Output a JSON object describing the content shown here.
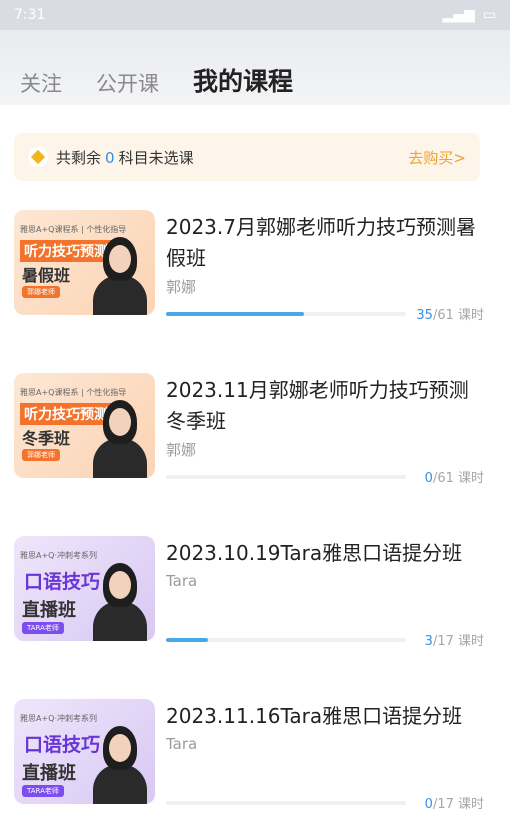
{
  "status_bar": {
    "time": "7:31"
  },
  "tabs": [
    {
      "label": "关注",
      "active": false
    },
    {
      "label": "公开课",
      "active": false
    },
    {
      "label": "我的课程",
      "active": true
    }
  ],
  "banner": {
    "prefix": "共剩余",
    "count": "0",
    "suffix": "科目未选课",
    "buy_label": "去购买>"
  },
  "courses": [
    {
      "title": "2023.7月郭娜老师听力技巧预测暑假班",
      "teacher": "郭娜",
      "done": "35",
      "total": "/61 课时",
      "progress": 0.574,
      "thumb": {
        "theme": "orange",
        "top": "雅思A+Q课程系 | 个性化指导",
        "line1": "听力技巧预测",
        "line2": "暑假班",
        "tag": "郭娜老师"
      }
    },
    {
      "title": "2023.11月郭娜老师听力技巧预测冬季班",
      "teacher": "郭娜",
      "done": "0",
      "total": "/61 课时",
      "progress": 0.0,
      "thumb": {
        "theme": "orange",
        "top": "雅思A+Q课程系 | 个性化指导",
        "line1": "听力技巧预测",
        "line2": "冬季班",
        "tag": "郭娜老师"
      }
    },
    {
      "title": "2023.10.19Tara雅思口语提分班",
      "teacher": "Tara",
      "done": "3",
      "total": "/17 课时",
      "progress": 0.176,
      "thumb": {
        "theme": "purple",
        "top": "雅思A+Q·冲刺考系列",
        "line1": "口语技巧",
        "line2": "直播班",
        "tag": "TARA老师"
      }
    },
    {
      "title": "2023.11.16Tara雅思口语提分班",
      "teacher": "Tara",
      "done": "0",
      "total": "/17 课时",
      "progress": 0.0,
      "thumb": {
        "theme": "purple",
        "top": "雅思A+Q·冲刺考系列",
        "line1": "口语技巧",
        "line2": "直播班",
        "tag": "TARA老师"
      }
    }
  ],
  "colors": {
    "accent_blue": "#3a8ee6",
    "progress_fill": "#4aa8e8",
    "buy_orange": "#f0a22d",
    "thumb_orange": "#f3732c",
    "thumb_purple": "#6a35d6"
  },
  "icons": {
    "banner": "diamond-icon"
  }
}
